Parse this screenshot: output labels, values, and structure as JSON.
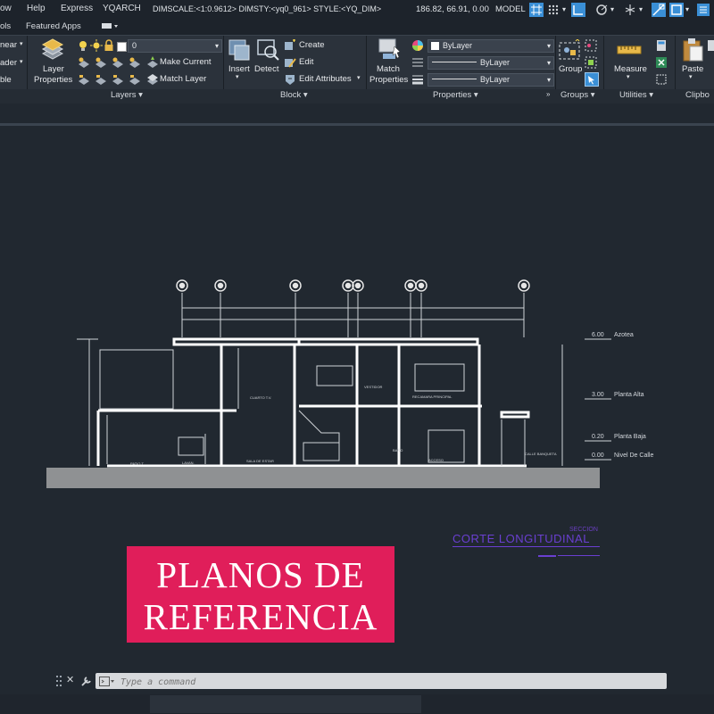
{
  "menu": [
    "ow",
    "Help",
    "Express",
    "YQARCH"
  ],
  "tabs": [
    "ols",
    "Featured Apps"
  ],
  "ribbon": {
    "linear": "near",
    "leader": "ader",
    "table": "ble",
    "layer_properties": [
      "Layer",
      "Properties"
    ],
    "layer_value": "0",
    "make_current": "Make Current",
    "match_layer": "Match Layer",
    "insert": "Insert",
    "detect": "Detect",
    "create": "Create",
    "edit": "Edit",
    "edit_attributes": "Edit Attributes",
    "match_properties": [
      "Match",
      "Properties"
    ],
    "color_value": "ByLayer",
    "linetype_value": "ByLayer",
    "lineweight_value": "ByLayer",
    "group": "Group",
    "measure": "Measure",
    "paste": "Paste",
    "panels": {
      "layers": "Layers ▾",
      "block": "Block ▾",
      "properties": "Properties ▾",
      "groups": "Groups ▾",
      "utilities": "Utilities ▾",
      "clipboard": "Clipbo"
    }
  },
  "drawing": {
    "levels": [
      {
        "value": "6.00",
        "label": "Azotea"
      },
      {
        "value": "3.00",
        "label": "Planta Alta"
      },
      {
        "value": "0.20",
        "label": "Planta Baja"
      },
      {
        "value": "0.00",
        "label": "Nivel De Calle"
      }
    ],
    "section_caption": "SECCION",
    "section_title": "CORTE LONGITUDINAL",
    "room_labels": [
      "PATIO T.",
      "LAVAN.",
      "SALA DE ESTAR",
      "CUARTO T.V.",
      "VESTIDOR",
      "RECAMARA PRINCIPAL",
      "BAÑO",
      "ACCESO",
      "CALLE\nBANQUETA"
    ]
  },
  "banner": {
    "line1": "PLANOS DE",
    "line2": "REFERENCIA",
    "color": "#e01e5a"
  },
  "command": {
    "placeholder": "Type a command"
  },
  "status": {
    "info": "DIMSCALE:<1:0.9612> DIMSTY:<yq0_961> STYLE:<YQ_DIM>",
    "coords": "186.82, 66.91, 0.00",
    "model": "MODEL"
  }
}
